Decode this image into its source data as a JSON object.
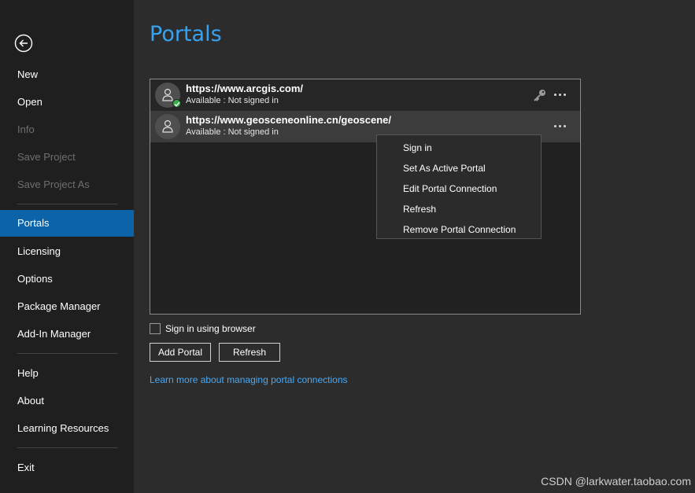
{
  "sidebar": {
    "items": [
      {
        "label": "New",
        "state": "enabled"
      },
      {
        "label": "Open",
        "state": "enabled"
      },
      {
        "label": "Info",
        "state": "disabled"
      },
      {
        "label": "Save Project",
        "state": "disabled"
      },
      {
        "label": "Save Project As",
        "state": "disabled"
      },
      {
        "label": "Portals",
        "state": "active"
      },
      {
        "label": "Licensing",
        "state": "enabled"
      },
      {
        "label": "Options",
        "state": "enabled"
      },
      {
        "label": "Package Manager",
        "state": "enabled"
      },
      {
        "label": "Add-In Manager",
        "state": "enabled"
      },
      {
        "label": "Help",
        "state": "enabled"
      },
      {
        "label": "About",
        "state": "enabled"
      },
      {
        "label": "Learning Resources",
        "state": "enabled"
      },
      {
        "label": "Exit",
        "state": "enabled"
      }
    ]
  },
  "main": {
    "title": "Portals",
    "portals": [
      {
        "url": "https://www.arcgis.com/",
        "status": "Available : Not signed in",
        "active": true
      },
      {
        "url": "https://www.geosceneonline.cn/geoscene/",
        "status": "Available : Not signed in",
        "active": false
      }
    ],
    "context_menu": [
      "Sign in",
      "Set As Active Portal",
      "Edit Portal Connection",
      "Refresh",
      "Remove Portal Connection"
    ],
    "sign_in_browser_label": "Sign in using browser",
    "sign_in_browser_checked": false,
    "add_portal_label": "Add Portal",
    "refresh_label": "Refresh",
    "learn_more_link": "Learn more about managing portal connections"
  },
  "watermark": "CSDN @larkwater.taobao.com",
  "colors": {
    "accent": "#0c63a8",
    "title": "#35a3f2",
    "link": "#4ca8f0",
    "active_badge": "#35ad48"
  }
}
